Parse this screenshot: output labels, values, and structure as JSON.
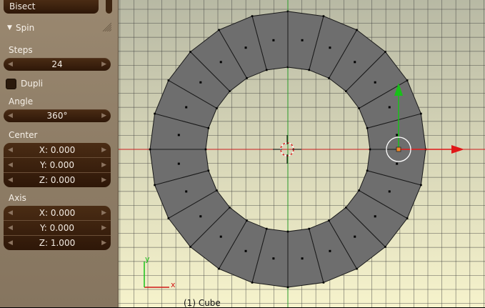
{
  "panel": {
    "bisect_label": "Bisect",
    "spin_header": "Spin",
    "steps_label": "Steps",
    "steps_value": "24",
    "dupli_label": "Dupli",
    "angle_label": "Angle",
    "angle_value": "360°",
    "center_label": "Center",
    "center": {
      "x": "X: 0.000",
      "y": "Y: 0.000",
      "z": "Z: 0.000"
    },
    "axis_label": "Axis",
    "axis": {
      "x": "X: 0.000",
      "y": "Y: 0.000",
      "z": "Z: 1.000"
    }
  },
  "viewport": {
    "status_text": "(1) Cube",
    "axis_gizmo": {
      "x_label": "x",
      "y_label": "y"
    },
    "colors": {
      "background": "#f3f1c9",
      "grid": "#3a3a3a",
      "x_axis": "#cc1e1e",
      "y_axis": "#2a9a2a",
      "mesh_face": "#6e6e6e",
      "mesh_edge": "#1a1a1a",
      "arrow_x": "#e01818",
      "arrow_y": "#18c018"
    },
    "mesh": {
      "segments": 24
    }
  }
}
